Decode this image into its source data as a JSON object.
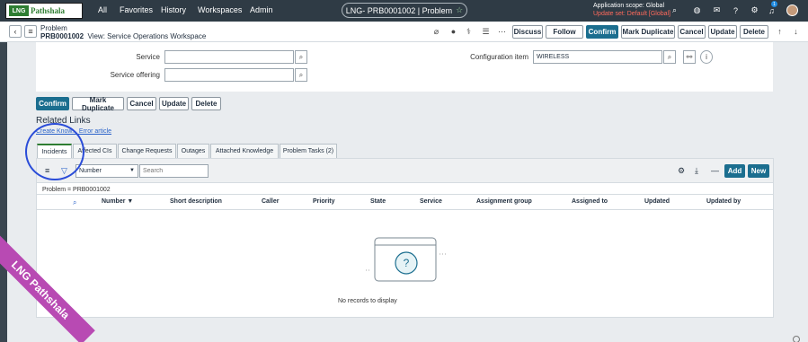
{
  "topnav": {
    "logo_badge": "LNG",
    "logo_text": "Pathshala",
    "links": [
      "All",
      "Favorites",
      "History",
      "Workspaces",
      "Admin"
    ],
    "record_pill": "LNG- PRB0001002 | Problem",
    "scope_line": "Application scope: Global",
    "update_set_line": "Update set: Default [Global]",
    "notification_count": "1"
  },
  "form_header": {
    "table_name": "Problem",
    "record_number": "PRB0001002",
    "view_label": "View: Service Operations Workspace",
    "buttons": {
      "discuss": "Discuss",
      "follow": "Follow",
      "confirm": "Confirm",
      "mark_duplicate": "Mark Duplicate",
      "cancel": "Cancel",
      "update": "Update",
      "delete": "Delete"
    }
  },
  "fields": {
    "service_label": "Service",
    "service_offering_label": "Service offering",
    "configuration_item_label": "Configuration item",
    "configuration_item_value": "WIRELESS"
  },
  "bottom_buttons": {
    "confirm": "Confirm",
    "mark_duplicate": "Mark Duplicate",
    "cancel": "Cancel",
    "update": "Update",
    "delete": "Delete"
  },
  "related": {
    "title": "Related Links",
    "links_text": "Create Know... Error article",
    "tabs": [
      "Incidents",
      "Affected CIs",
      "Change Requests",
      "Outages",
      "Attached Knowledge",
      "Problem Tasks (2)"
    ],
    "search_field": "Number",
    "search_placeholder": "Search",
    "new_button": "New",
    "add_button": "Add",
    "filter_breadcrumb": "Problem = PRB0001002",
    "columns": [
      "Number",
      "Short description",
      "Caller",
      "Priority",
      "State",
      "Service",
      "Assignment group",
      "Assigned to",
      "Updated",
      "Updated by"
    ],
    "empty_message": "No records to display"
  },
  "watermark": "LNG Pathshala"
}
